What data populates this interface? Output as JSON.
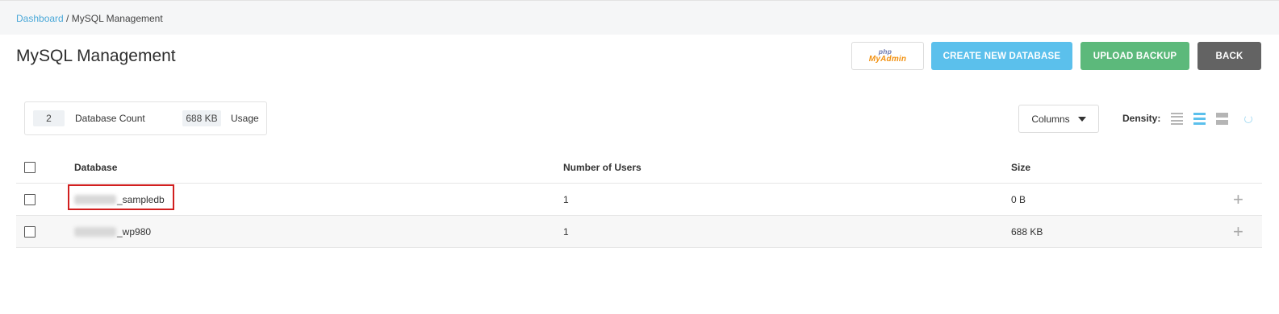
{
  "breadcrumb": {
    "home": "Dashboard",
    "separator": " / ",
    "current": "MySQL Management"
  },
  "page": {
    "title": "MySQL Management"
  },
  "toolbar": {
    "phpmyadmin_top": "php",
    "phpmyadmin_bottom": "MyAdmin",
    "create_label": "CREATE NEW DATABASE",
    "upload_label": "UPLOAD BACKUP",
    "back_label": "BACK"
  },
  "stats": {
    "database_count_value": "2",
    "database_count_label": "Database Count",
    "usage_value": "688 KB",
    "usage_label": "Usage"
  },
  "controls": {
    "columns_label": "Columns",
    "density_label": "Density:",
    "density_options": [
      "compact-icon",
      "normal-icon",
      "comfortable-icon"
    ],
    "density_selected": "normal"
  },
  "table": {
    "headers": {
      "database": "Database",
      "users": "Number of Users",
      "size": "Size"
    },
    "rows": [
      {
        "database": "_sampledb",
        "users": "1",
        "size": "0 B"
      },
      {
        "database": "_wp980",
        "users": "1",
        "size": "688 KB"
      }
    ],
    "expand_symbol": "+"
  },
  "colors": {
    "create_button": "#5bc0ec",
    "upload_button": "#5cb97b",
    "back_button": "#636363",
    "link": "#4aa8d8",
    "highlight": "#d11f1f"
  }
}
